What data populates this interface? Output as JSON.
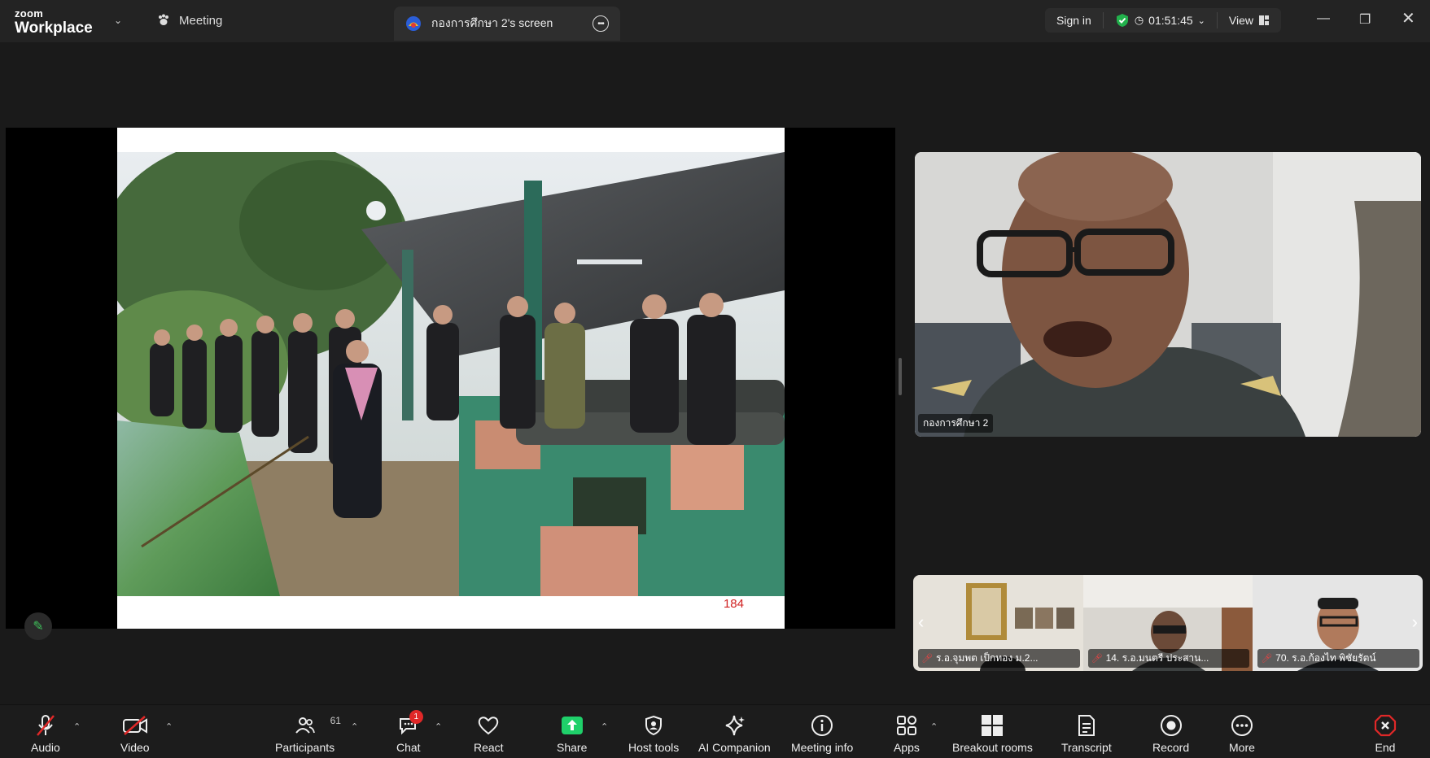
{
  "titlebar": {
    "brand_top": "zoom",
    "brand_bottom": "Workplace",
    "meeting_label": "Meeting",
    "share_tab_label": "กองการศึกษา 2's screen",
    "sign_in": "Sign in",
    "timer": "01:51:45",
    "view": "View"
  },
  "stage": {
    "page_number": "184"
  },
  "speaker": {
    "name": "กองการศึกษา 2"
  },
  "participants_strip": [
    {
      "name": "ร.อ.จุมพต   เป็กทอง ม.2..."
    },
    {
      "name": "14. ร.อ.มนตรี ประสาน..."
    },
    {
      "name": "70. ร.อ.ก้องไท พิชัยรัตน์"
    }
  ],
  "toolbar": {
    "audio": "Audio",
    "video": "Video",
    "participants": "Participants",
    "participants_count": "61",
    "chat": "Chat",
    "chat_badge": "1",
    "react": "React",
    "share": "Share",
    "host_tools": "Host tools",
    "ai_companion": "AI Companion",
    "meeting_info": "Meeting info",
    "apps": "Apps",
    "breakout_rooms": "Breakout rooms",
    "transcript": "Transcript",
    "record": "Record",
    "more": "More",
    "end": "End"
  },
  "colors": {
    "end_red": "#e02828",
    "share_green": "#1fd06a",
    "secure_green": "#22b14c"
  }
}
